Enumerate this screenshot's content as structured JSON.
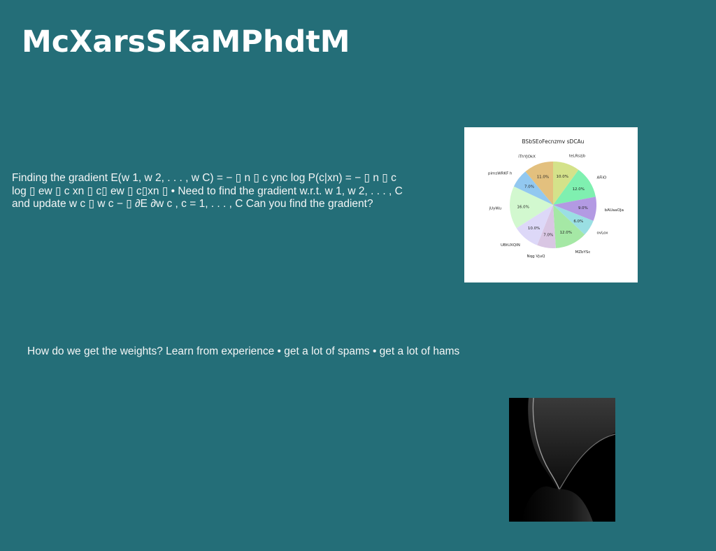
{
  "slide": {
    "title": "McXarsSKaMPhdtM",
    "paragraph_1": "Finding the gradient E(w 1, w 2, . . . , w C) = − ▯ n ▯ c ync log P(c|xn) = − ▯ n ▯ c log ▯ ew ▯ c xn ▯ c▯ ew ▯ c▯xn ▯ • Need to find the gradient w.r.t. w 1, w 2, . . . , C and update w c ▯ w c − ▯ ∂E ∂w c , c = 1, . . . , C Can you find the gradient?",
    "paragraph_2": "How do we get the weights? Learn from experience • get a lot of spams • get a lot of hams"
  },
  "image": {
    "name": "abstract-dark-shape-image"
  },
  "chart_data": {
    "type": "pie",
    "title": "BSbSEoFecnzmv sDCAu",
    "start_angle_deg": 90,
    "direction": "clockwise",
    "slices": [
      {
        "label": "teLRszjb",
        "value": 10.0,
        "pct": "10.0%",
        "color": "#d4e28a"
      },
      {
        "label": "AFiiO",
        "value": 12.0,
        "pct": "12.0%",
        "color": "#7ff0b0"
      },
      {
        "label": "bAUaaOJa",
        "value": 9.0,
        "pct": "9.0%",
        "color": "#b39ae3"
      },
      {
        "label": "ovLox",
        "value": 6.0,
        "pct": "6.0%",
        "color": "#9adfe3"
      },
      {
        "label": "MZbYSc",
        "value": 12.0,
        "pct": "12.0%",
        "color": "#a5e8a5"
      },
      {
        "label": "Nqg VjuQ",
        "value": 7.0,
        "pct": "7.0%",
        "color": "#d9c6e3"
      },
      {
        "label": "UBtUXQIN",
        "value": 10.0,
        "pct": "10.0%",
        "color": "#ddd8f8"
      },
      {
        "label": "jUyWu",
        "value": 16.0,
        "pct": "16.0%",
        "color": "#d2f8cf"
      },
      {
        "label": "pimsWRKF h",
        "value": 7.0,
        "pct": "7.0%",
        "color": "#92c8f0"
      },
      {
        "label": "iThYJOkX",
        "value": 11.0,
        "pct": "11.0%",
        "color": "#e3c07e"
      }
    ]
  }
}
